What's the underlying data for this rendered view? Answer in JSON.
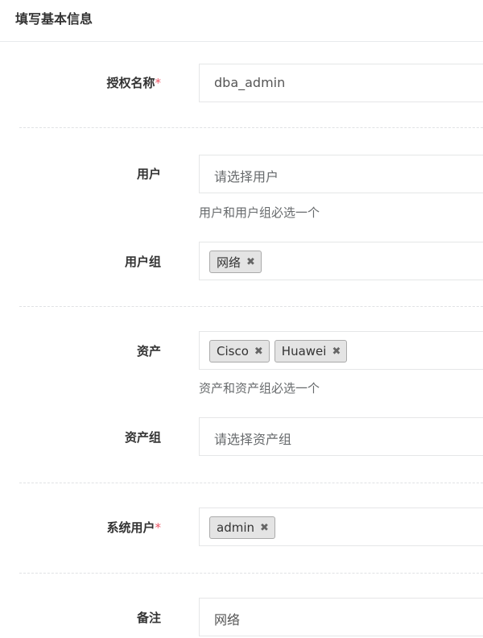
{
  "section": {
    "title": "填写基本信息"
  },
  "form": {
    "name": {
      "label": "授权名称",
      "required": "*",
      "value": "dba_admin"
    },
    "user": {
      "label": "用户",
      "placeholder": "请选择用户",
      "help": "用户和用户组必选一个"
    },
    "user_group": {
      "label": "用户组",
      "tags": [
        "网络"
      ]
    },
    "asset": {
      "label": "资产",
      "tags": [
        "Cisco",
        "Huawei"
      ],
      "help": "资产和资产组必选一个"
    },
    "asset_group": {
      "label": "资产组",
      "placeholder": "请选择资产组"
    },
    "system_user": {
      "label": "系统用户",
      "required": "*",
      "tags": [
        "admin"
      ]
    },
    "comment": {
      "label": "备注",
      "value": "网络"
    }
  },
  "icons": {
    "tag_remove": "close-icon"
  },
  "tag_remove_glyph": "✖"
}
